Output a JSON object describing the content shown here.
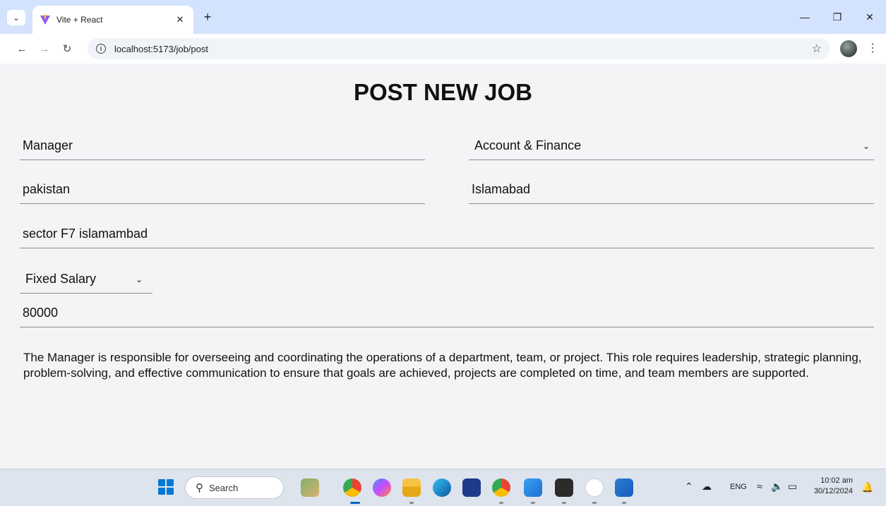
{
  "browser": {
    "tab_title": "Vite + React",
    "url": "localhost:5173/job/post"
  },
  "page": {
    "title": "POST NEW JOB"
  },
  "form": {
    "job_title": "Manager",
    "category": "Account & Finance",
    "country": "pakistan",
    "city": "Islamabad",
    "location": "sector F7 islamambad",
    "salary_type": "Fixed Salary",
    "salary": "80000",
    "description": "The Manager is responsible for overseeing and coordinating the operations of a department, team, or project. This role requires leadership, strategic planning, problem-solving, and effective communication to ensure that goals are achieved, projects are completed on time, and team members are supported."
  },
  "taskbar": {
    "search_label": "Search",
    "language": "ENG",
    "time": "10:02 am",
    "date": "30/12/2024"
  },
  "colors": {
    "vite_purple": "#8b5cf6",
    "windows_blue": "#0078d4"
  }
}
